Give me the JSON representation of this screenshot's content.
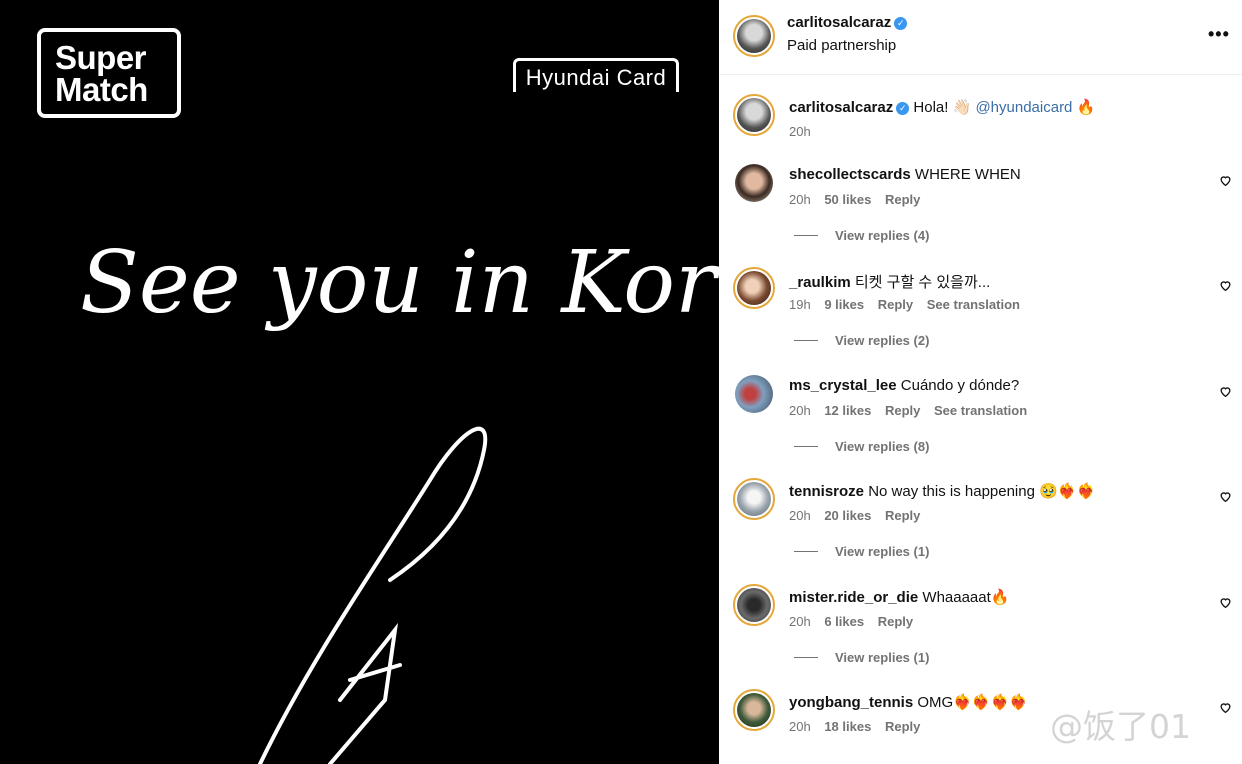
{
  "media": {
    "super_match_line1": "Super",
    "super_match_line2": "Match",
    "hyundai_card": "Hyundai Card",
    "headline": "See you in Korea!"
  },
  "header": {
    "username": "carlitosalcaraz",
    "subtitle": "Paid partnership",
    "more_icon": "•••"
  },
  "caption": {
    "username": "carlitosalcaraz",
    "text": "Hola! 👋🏻",
    "mention": "@hyundaicard",
    "emoji": "🔥",
    "time": "20h"
  },
  "comments": [
    {
      "username": "shecollectscards",
      "text": "WHERE WHEN",
      "time": "20h",
      "likes": "50 likes",
      "reply": "Reply",
      "translation": "",
      "view_replies": "View replies (4)"
    },
    {
      "username": "_raulkim",
      "text": "티켓 구할 수 있을까...",
      "time": "19h",
      "likes": "9 likes",
      "reply": "Reply",
      "translation": "See translation",
      "view_replies": "View replies (2)"
    },
    {
      "username": "ms_crystal_lee",
      "text": "Cuándo y dónde?",
      "time": "20h",
      "likes": "12 likes",
      "reply": "Reply",
      "translation": "See translation",
      "view_replies": "View replies (8)"
    },
    {
      "username": "tennisroze",
      "text": "No way this is happening 🥹❤️‍🔥❤️‍🔥",
      "time": "20h",
      "likes": "20 likes",
      "reply": "Reply",
      "translation": "",
      "view_replies": "View replies (1)"
    },
    {
      "username": "mister.ride_or_die",
      "text": "Whaaaaat🔥",
      "time": "20h",
      "likes": "6 likes",
      "reply": "Reply",
      "translation": "",
      "view_replies": "View replies (1)"
    },
    {
      "username": "yongbang_tennis",
      "text": "OMG❤️‍🔥❤️‍🔥❤️‍🔥❤️‍🔥",
      "time": "20h",
      "likes": "18 likes",
      "reply": "Reply",
      "translation": "",
      "view_replies": ""
    }
  ],
  "watermark": "@饭了01",
  "colors": {
    "accent_link": "#3b6ea5",
    "verified": "#3897f0",
    "story_ring": "#e4a73a"
  }
}
